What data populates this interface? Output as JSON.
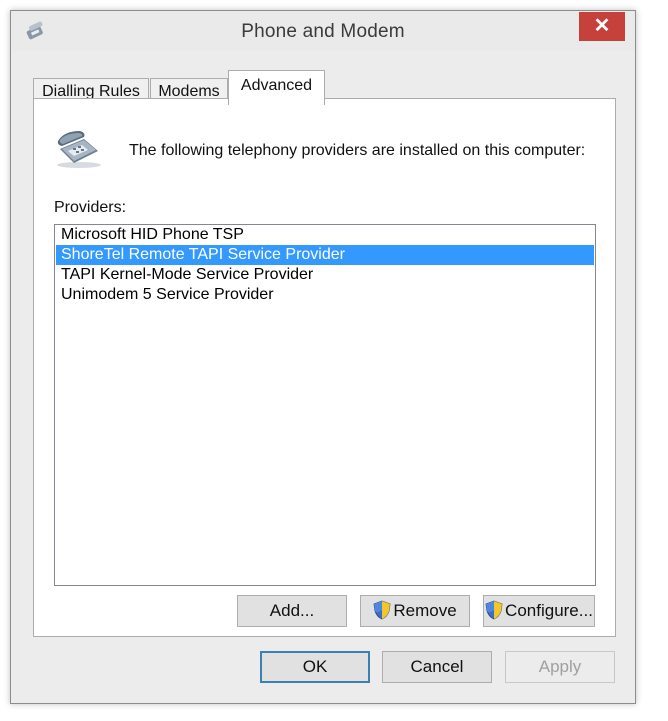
{
  "window": {
    "title": "Phone and Modem",
    "close_label": "✕"
  },
  "tabs": [
    {
      "label": "Dialling Rules"
    },
    {
      "label": "Modems"
    },
    {
      "label": "Advanced",
      "active": true
    }
  ],
  "advanced": {
    "info_text": "The following telephony providers are installed on this computer:",
    "providers_label": "Providers:",
    "providers": [
      {
        "label": "Microsoft HID Phone TSP",
        "selected": false
      },
      {
        "label": "ShoreTel Remote TAPI Service Provider",
        "selected": true
      },
      {
        "label": "TAPI Kernel-Mode Service Provider",
        "selected": false
      },
      {
        "label": "Unimodem 5 Service Provider",
        "selected": false
      }
    ],
    "buttons": {
      "add": "Add...",
      "remove": "Remove",
      "configure": "Configure..."
    }
  },
  "footer": {
    "ok": "OK",
    "cancel": "Cancel",
    "apply": "Apply"
  },
  "colors": {
    "selection": "#3399ff",
    "close": "#c7413c",
    "default_border": "#3c7fb1"
  },
  "icons": [
    "phone-modem-icon",
    "telephone-icon",
    "uac-shield-icon",
    "close-icon"
  ]
}
